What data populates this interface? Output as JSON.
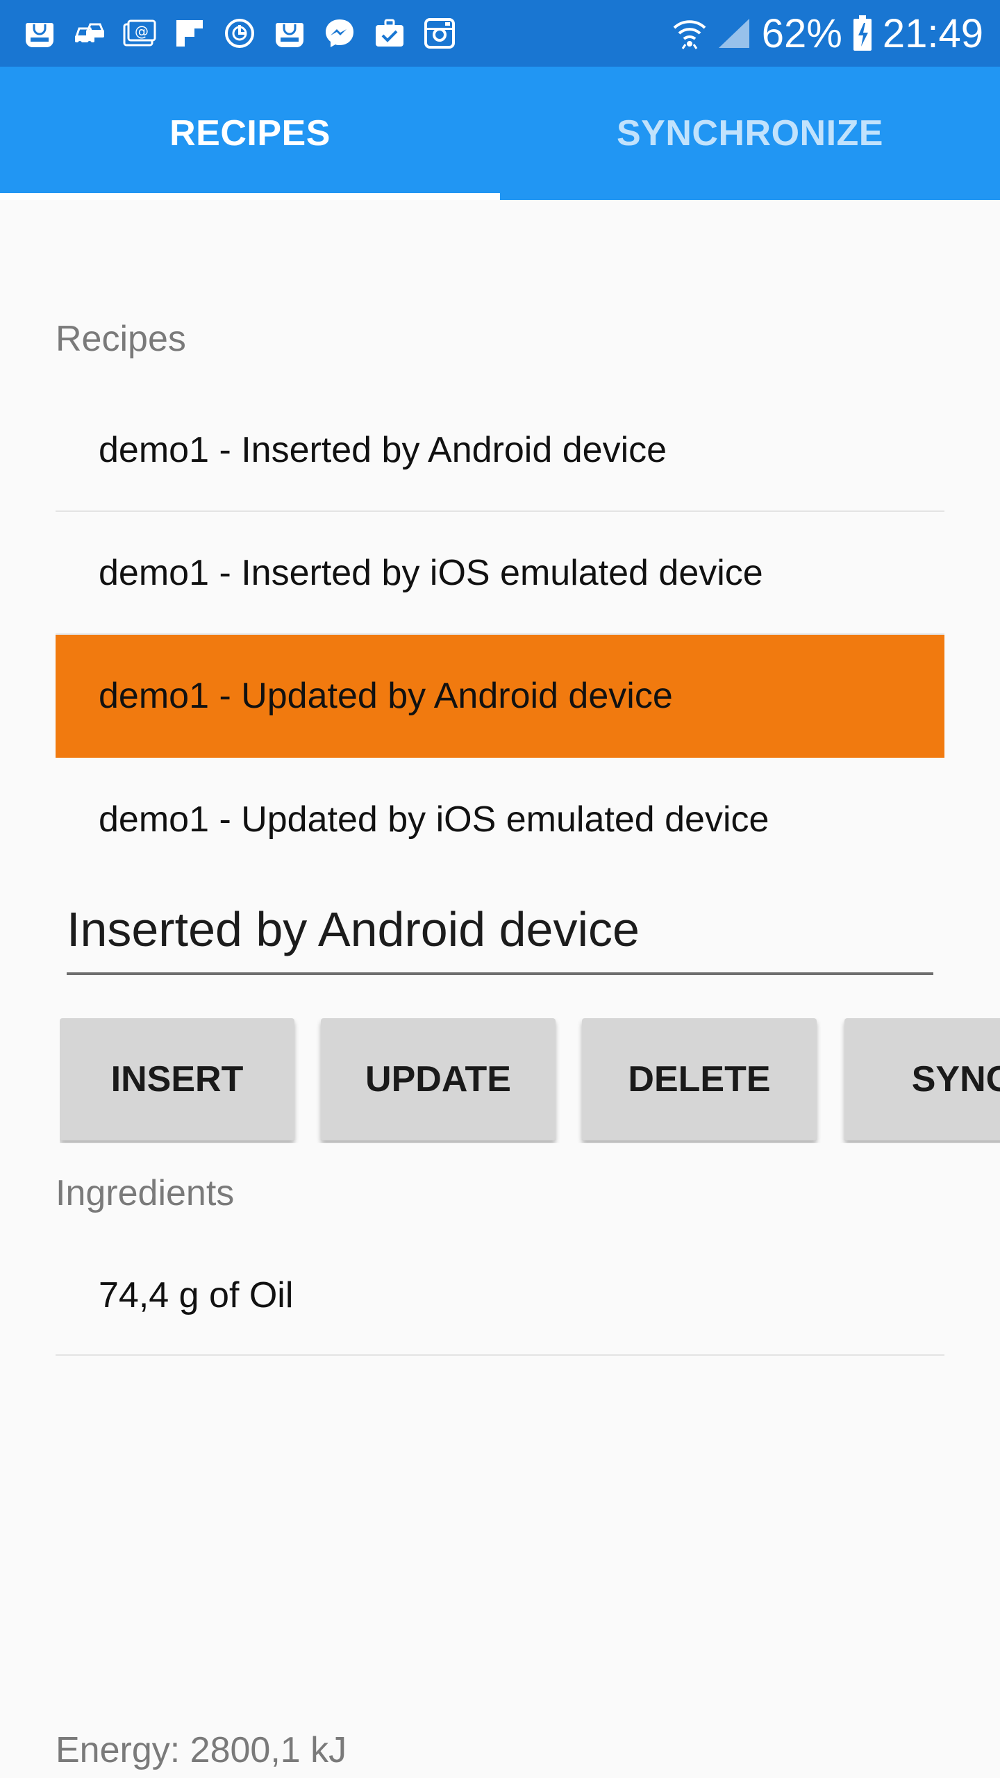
{
  "status_bar": {
    "notification_icons": [
      "galaxy-apps-icon",
      "car-icon",
      "email-icon",
      "flipboard-icon",
      "sync-icon",
      "galaxy-store-icon",
      "messenger-icon",
      "briefcase-check-icon",
      "instagram-icon"
    ],
    "battery": "62%",
    "time": "21:49"
  },
  "tabs": [
    {
      "label": "RECIPES",
      "active": true
    },
    {
      "label": "SYNCHRONIZE",
      "active": false
    }
  ],
  "recipes": {
    "label": "Recipes",
    "items": [
      {
        "text": "demo1 - Inserted by Android device",
        "selected": false
      },
      {
        "text": "demo1 - Inserted by iOS emulated device",
        "selected": false
      },
      {
        "text": "demo1 - Updated by Android device",
        "selected": true
      },
      {
        "text": "demo1 - Updated by iOS emulated device",
        "selected": false
      }
    ]
  },
  "name_field": {
    "value": "Inserted by Android device"
  },
  "buttons": {
    "insert": "INSERT",
    "update": "UPDATE",
    "delete": "DELETE",
    "sync": "SYNC"
  },
  "ingredients": {
    "label": "Ingredients",
    "items": [
      "74,4 g of Oil"
    ]
  },
  "energy": "Energy: 2800,1 kJ",
  "colors": {
    "status_bar": "#1976d2",
    "tab_bar": "#2196f3",
    "selected_row": "#f17a0f"
  }
}
